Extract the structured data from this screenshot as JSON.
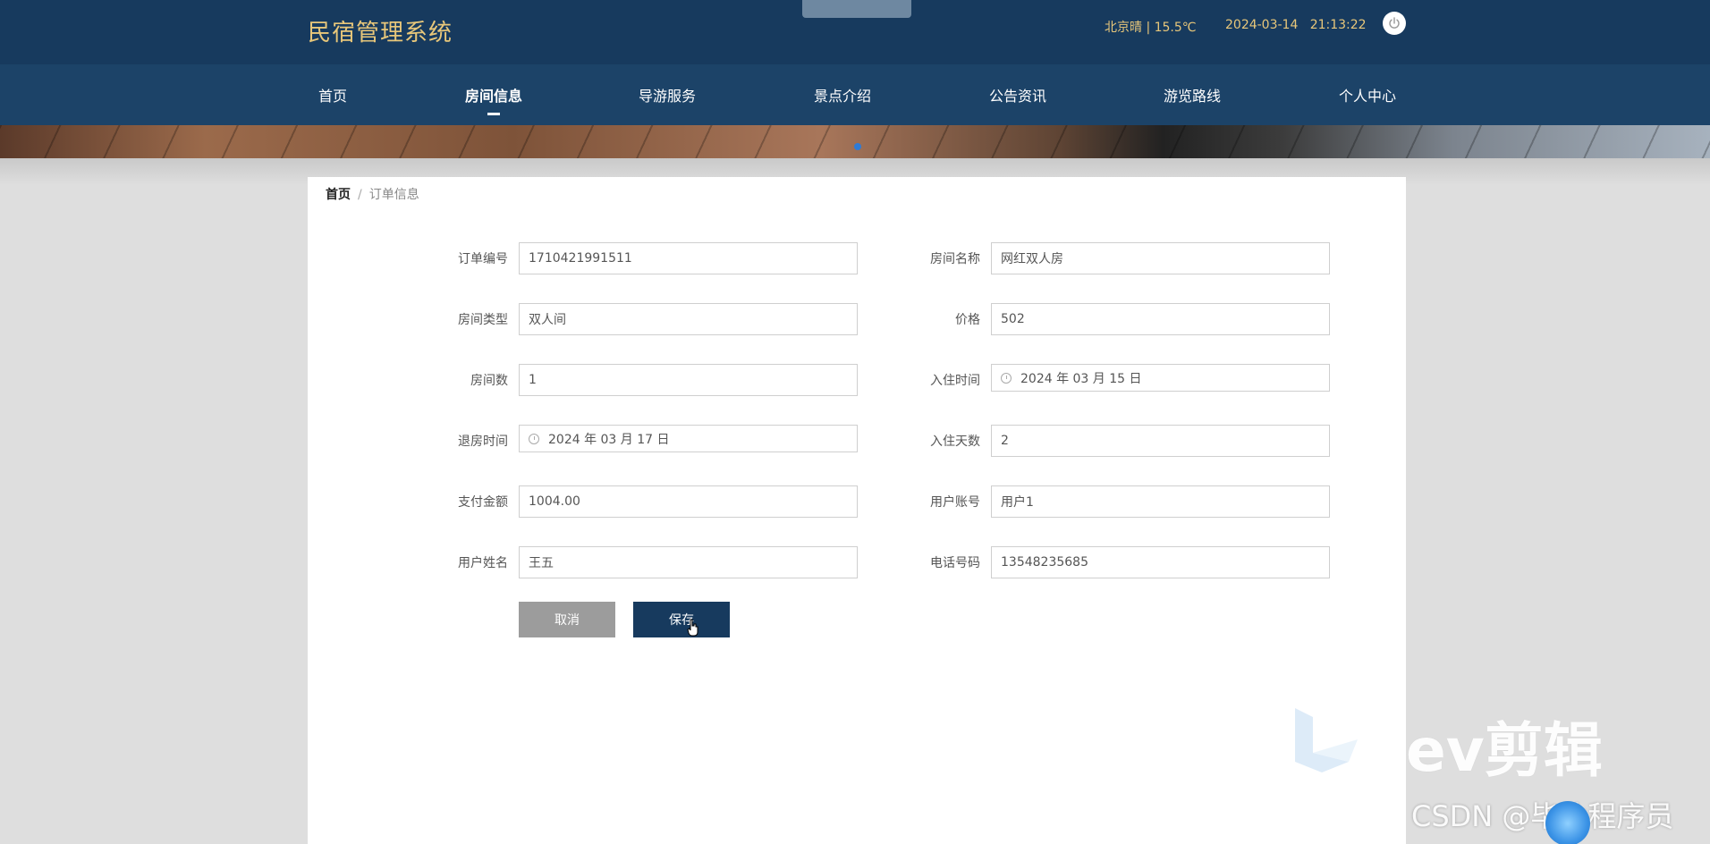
{
  "header": {
    "brand": "民宿管理系统",
    "weather": "北京晴 | 15.5℃",
    "datetime": "2024-03-14   21:13:22"
  },
  "nav": {
    "items": [
      {
        "label": "首页"
      },
      {
        "label": "房间信息"
      },
      {
        "label": "导游服务"
      },
      {
        "label": "景点介绍"
      },
      {
        "label": "公告资讯"
      },
      {
        "label": "游览路线"
      },
      {
        "label": "个人中心"
      }
    ],
    "active": "房间信息"
  },
  "breadcrumb": {
    "home": "首页",
    "separator": "/",
    "current": "订单信息"
  },
  "form": {
    "order_no": {
      "label": "订单编号",
      "value": "1710421991511"
    },
    "room_name": {
      "label": "房间名称",
      "value": "网红双人房"
    },
    "room_type": {
      "label": "房间类型",
      "value": "双人间"
    },
    "price": {
      "label": "价格",
      "value": "502"
    },
    "room_count": {
      "label": "房间数",
      "value": "1"
    },
    "checkin_time": {
      "label": "入住时间",
      "value": "2024 年 03 月 15 日"
    },
    "checkout_time": {
      "label": "退房时间",
      "value": "2024 年 03 月 17 日"
    },
    "stay_days": {
      "label": "入住天数",
      "value": "2"
    },
    "pay_amount": {
      "label": "支付金额",
      "value": "1004.00"
    },
    "user_account": {
      "label": "用户账号",
      "value": "用户1"
    },
    "user_name": {
      "label": "用户姓名",
      "value": "王五"
    },
    "phone": {
      "label": "电话号码",
      "value": "13548235685"
    }
  },
  "buttons": {
    "cancel": "取消",
    "save": "保存"
  },
  "watermark": {
    "editor": "ev剪辑",
    "csdn": "CSDN @毕业程序员"
  },
  "colors": {
    "header_bg": "#173a5e",
    "nav_bg": "#1c4368",
    "brand_gold": "#e8c77a",
    "save_button": "#173a5e",
    "cancel_button": "#9c9c9c"
  }
}
